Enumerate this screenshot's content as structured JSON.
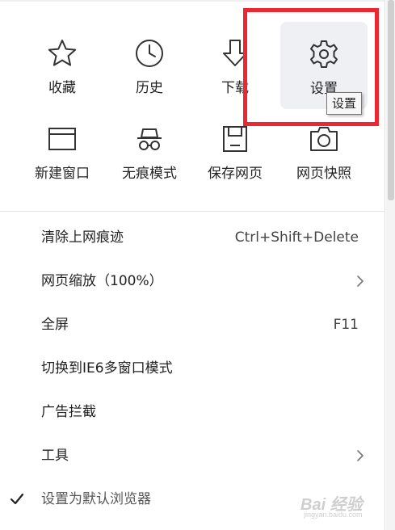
{
  "quick_access": [
    {
      "label": "收藏",
      "icon": "star-icon"
    },
    {
      "label": "历史",
      "icon": "clock-icon"
    },
    {
      "label": "下载",
      "icon": "download-icon"
    },
    {
      "label": "设置",
      "icon": "gear-icon",
      "active": true
    },
    {
      "label": "新建窗口",
      "icon": "window-icon"
    },
    {
      "label": "无痕模式",
      "icon": "incognito-icon"
    },
    {
      "label": "保存网页",
      "icon": "save-icon"
    },
    {
      "label": "网页快照",
      "icon": "camera-icon"
    }
  ],
  "tooltip": "设置",
  "menu": [
    {
      "label": "清除上网痕迹",
      "shortcut": "Ctrl+Shift+Delete"
    },
    {
      "label": "网页缩放（100%）",
      "submenu": true
    },
    {
      "label": "全屏",
      "shortcut": "F11"
    },
    {
      "label": "切换到IE6多窗口模式"
    },
    {
      "label": "广告拦截"
    },
    {
      "label": "工具",
      "submenu": true
    },
    {
      "label": "设置为默认浏览器",
      "checked": true
    }
  ],
  "watermark": {
    "main": "Bai 经验",
    "sub": "jingyan.baidu.com"
  },
  "colors": {
    "highlight": "#ec2731",
    "active_tile": "#eef0f4",
    "icon_stroke": "#333333"
  }
}
